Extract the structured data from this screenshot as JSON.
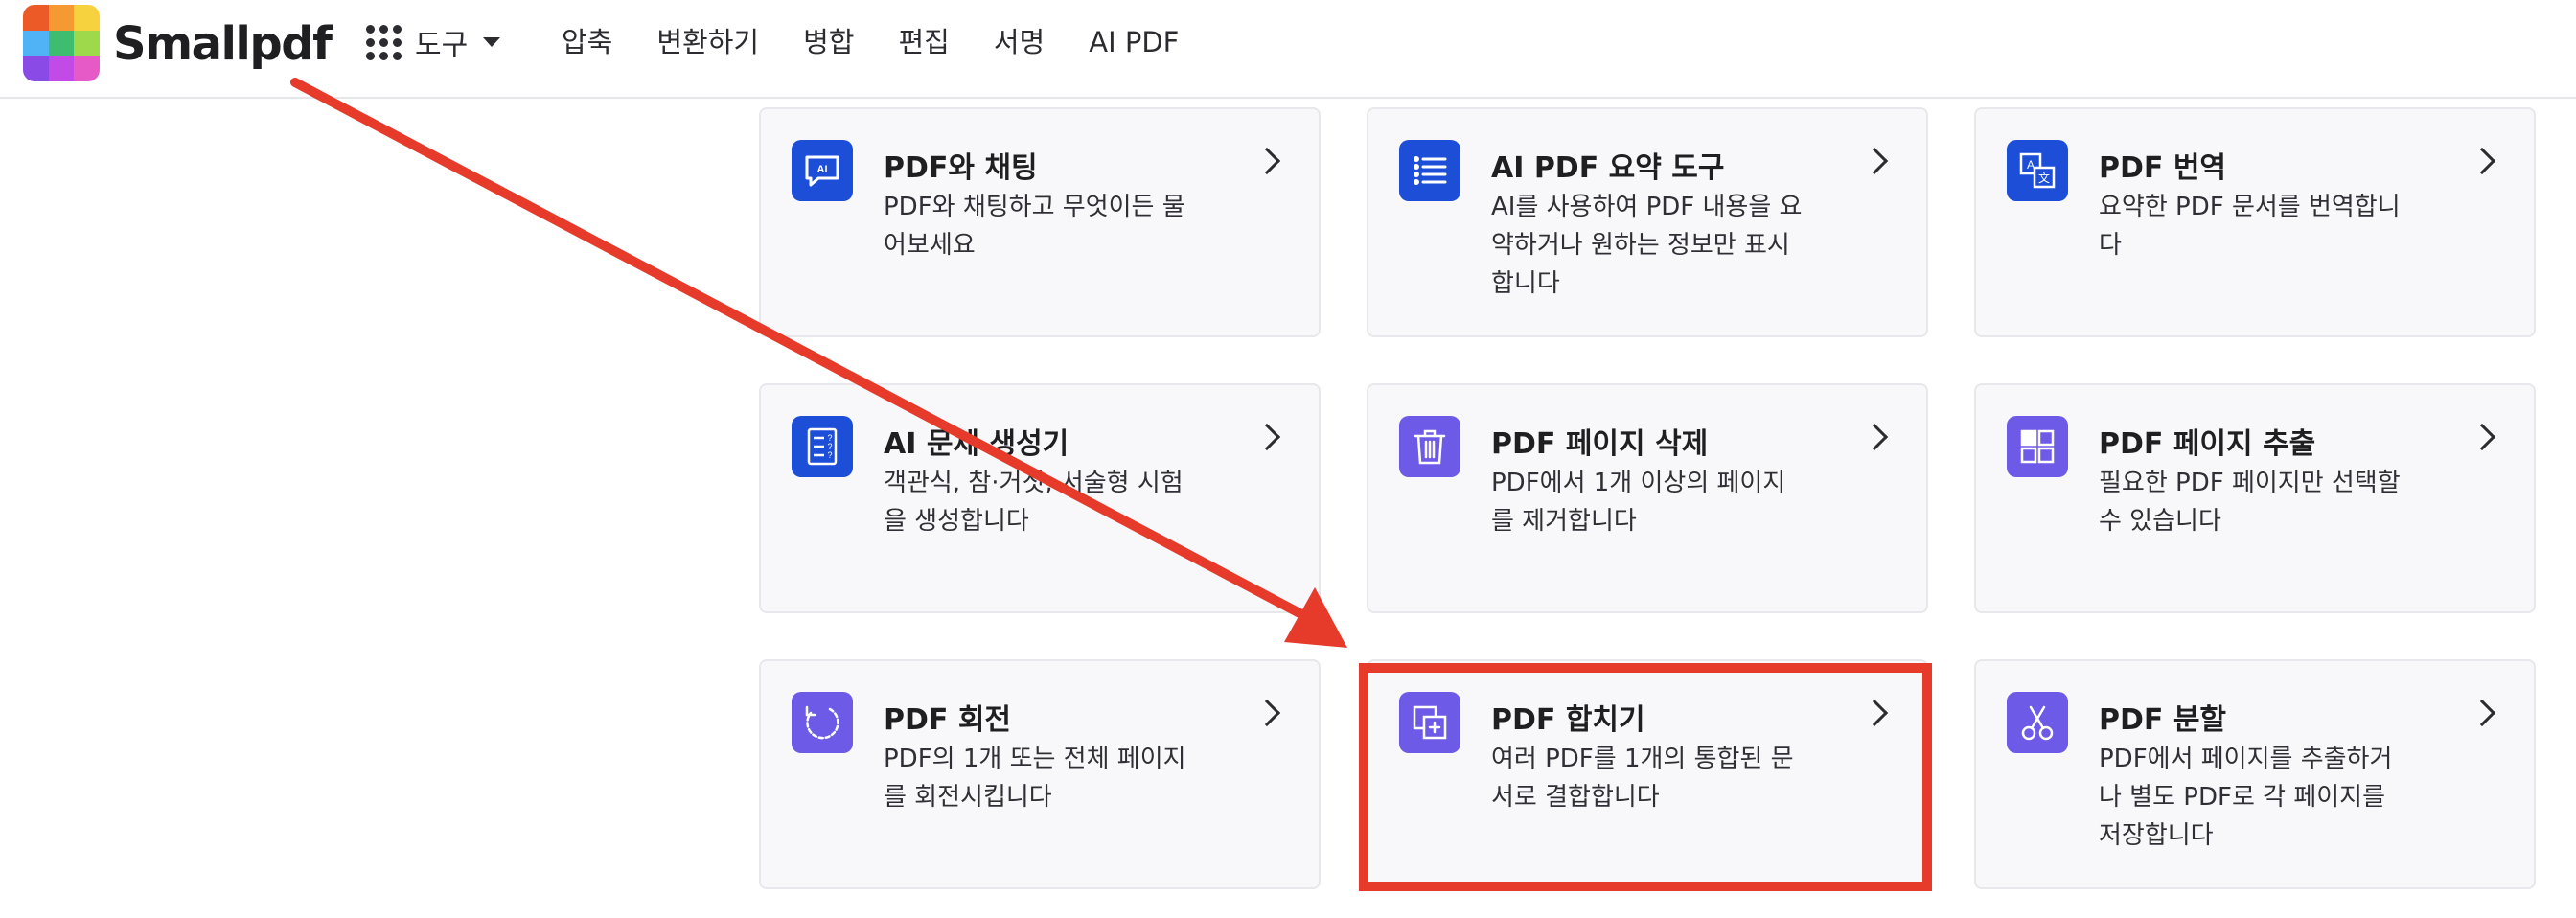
{
  "header": {
    "brand": "Smallpdf",
    "logo_colors": [
      "#ec5a28",
      "#f59a32",
      "#f7d23f",
      "#4fb3f5",
      "#3dbd6d",
      "#9dd94a",
      "#8a4ae6",
      "#c24ae6",
      "#e65ac8"
    ],
    "tools_label": "도구",
    "nav": [
      "압축",
      "변환하기",
      "병합",
      "편집",
      "서명",
      "AI PDF"
    ]
  },
  "cards": [
    {
      "title": "PDF와 채팅",
      "desc": "PDF와 채팅하고 무엇이든 물어보세요",
      "icon": "ai-chat-icon",
      "color": "blue"
    },
    {
      "title": "AI PDF 요약 도구",
      "desc": "AI를 사용하여 PDF 내용을 요약하거나 원하는 정보만 표시합니다",
      "icon": "summary-list-icon",
      "color": "blue"
    },
    {
      "title": "PDF 번역",
      "desc": "요약한 PDF 문서를 번역합니다",
      "icon": "translate-icon",
      "color": "blue"
    },
    {
      "title": "AI 문제 생성기",
      "desc": "객관식, 참·거짓, 서술형 시험을 생성합니다",
      "icon": "quiz-icon",
      "color": "blue"
    },
    {
      "title": "PDF 페이지 삭제",
      "desc": "PDF에서 1개 이상의 페이지를 제거합니다",
      "icon": "trash-icon",
      "color": "purple"
    },
    {
      "title": "PDF 페이지 추출",
      "desc": "필요한 PDF 페이지만 선택할 수 있습니다",
      "icon": "extract-grid-icon",
      "color": "purple"
    },
    {
      "title": "PDF 회전",
      "desc": "PDF의 1개 또는 전체 페이지를 회전시킵니다",
      "icon": "rotate-icon",
      "color": "purple"
    },
    {
      "title": "PDF 합치기",
      "desc": "여러 PDF를 1개의 통합된 문서로 결합합니다",
      "icon": "merge-icon",
      "color": "purple"
    },
    {
      "title": "PDF 분할",
      "desc": "PDF에서 페이지를 추출하거나 별도 PDF로 각 페이지를 저장합니다",
      "icon": "scissors-icon",
      "color": "purple"
    }
  ],
  "annotation": {
    "color": "#e63a2a",
    "highlighted": "PDF 합치기"
  }
}
